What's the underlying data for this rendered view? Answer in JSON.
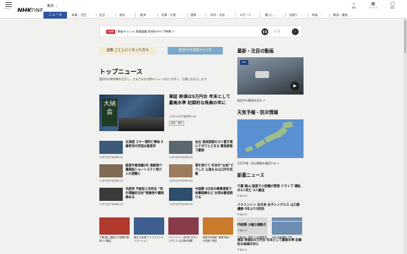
{
  "header": {
    "menu_caption": "メニュー",
    "logo_nhk": "NHK",
    "logo_one": "ONE",
    "region": "東京 ⌄",
    "icons": [
      {
        "name": "search-icon",
        "glyph": "⌕",
        "label": "検索"
      },
      {
        "name": "service-icon",
        "glyph": "▦",
        "label": "サービス"
      },
      {
        "name": "account-icon",
        "glyph": "◯",
        "label": "設定"
      }
    ]
  },
  "nav": {
    "active": "ニュース",
    "items": [
      "新着・注目",
      "社会",
      "政治",
      "経済",
      "気象・災害",
      "国際",
      "科学・文化",
      "スポーツ",
      "暮らし",
      "深掘り",
      "地域",
      "動画・番組"
    ]
  },
  "live": {
    "badge": "LIVE",
    "text": "帰省ラッシュ 高速道路 各地のライブ映像 >",
    "pager": "1 / 5"
  },
  "banners": [
    {
      "text": "迎春 ことしにくなった方々"
    },
    {
      "text": "能登半島地震から2年"
    }
  ],
  "top_news": {
    "title": "トップニュース",
    "lead": "国内外の取材網を生かし、さまざまな分野のニュースをいち早く、正確にお伝えします",
    "hero": {
      "sign": "大納会",
      "title": "東証 終値は5万円台 年末として最高水準 記録的な株高の年に",
      "time": "12月30日午後6時12分",
      "tag": "動画・番組"
    },
    "items": [
      {
        "title": "北海道 スキー場死亡事故 5歳男児の死因は窒息死",
        "date": "12月30日午後5時51分",
        "color": "#3d5a7a"
      },
      {
        "title": "仙台 温泉旅館のゴミ置き場にテダマとどまる 緊急銃猟で駆除",
        "date": "12月30日午後5時55分",
        "color": "#5a6670"
      },
      {
        "title": "能登半島地震2年 高齢者介護施設ショートステイ受け入れ困難に",
        "date": "12月30日午後5時51分",
        "color": "#7e6a55"
      },
      {
        "title": "害を受けて 年末の“お金”どうした 心温まる山口市の活動",
        "date": "12月30日午後5時15分",
        "color": "#9b7d5e"
      },
      {
        "title": "共産党 不破哲三氏死去 “党の理論的支柱”委員長や議長務める",
        "date": "12月30日午後6時01分",
        "color": "#3c3a38"
      },
      {
        "title": "中国軍 2日目の軍事演習で射撃訓練など 台湾は警戒続ける",
        "date": "12月30日午後4時55分",
        "color": "#2f4e6b"
      }
    ],
    "bottom": [
      {
        "title": "千葉 館山 国道で小型機が墜落 5人搬送",
        "color": "#b03a2e"
      },
      {
        "title": "東京 お台場 クリスマスイルミネーション",
        "color": "#3e5f8f"
      },
      {
        "title": "バドミントン 全日本 女子シングルス 山口茜が優勝",
        "color": "#8a3b4a"
      },
      {
        "title": "能登半島地震 “黄昏 珠洲” の記録と復旧",
        "color": "#c97a2b"
      },
      {
        "title": "千葉 館山 国道で小型機墜落",
        "color": "#d9d9d9"
      },
      {
        "title": "大阪 高速道路 渋滞",
        "color": "#6c8db0"
      }
    ]
  },
  "right": {
    "video_title": "最新・注目の動画",
    "video_badge": "NHK",
    "video_link": "配信中の動画を見る >",
    "weather_title": "天気予報・防災情報",
    "weather_link": "天気予報・防災情報を確認する >",
    "news_title": "新着ニュース",
    "news": [
      {
        "title": "千葉 館山 国道で小型機が墜落 ドライブ 運転の1人死亡 3人搬送",
        "time": "午後6:38"
      },
      {
        "title": "バドミントン 全日本 女子シングルス 山口茜 優勝 5年ぶり5回目",
        "time": "午後6:35"
      },
      {
        "title": "円相場 小幅な値動き",
        "time": "午後6:21"
      },
      {
        "title": "東証 終値は5万円台 年末として最高水準 記録的な株高の年に",
        "time": "午後6:12"
      }
    ]
  }
}
